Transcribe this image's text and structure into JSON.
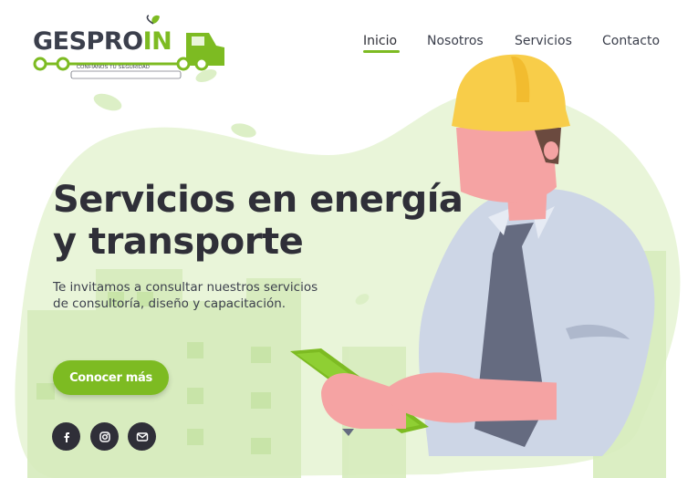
{
  "brand": {
    "logo_main": "GESPRO",
    "logo_accent": "IN",
    "tagline": "CONFÍANOS TU SEGURIDAD"
  },
  "nav": {
    "items": [
      {
        "label": "Inicio",
        "active": true
      },
      {
        "label": "Nosotros",
        "active": false
      },
      {
        "label": "Servicios",
        "active": false
      },
      {
        "label": "Contacto",
        "active": false
      }
    ]
  },
  "hero": {
    "title_line1": "Servicios en energía",
    "title_line2": "y transporte",
    "subtitle_line1": "Te invitamos a consultar nuestros servicios",
    "subtitle_line2": "de consultoría, diseño y capacitación.",
    "cta_label": "Conocer más"
  },
  "social": [
    {
      "name": "facebook-icon"
    },
    {
      "name": "instagram-icon"
    },
    {
      "name": "email-icon"
    }
  ],
  "colors": {
    "accent": "#7dbb22",
    "dark": "#2f2f38",
    "blob": "#e9f5d9",
    "helmet": "#f8cd49"
  }
}
